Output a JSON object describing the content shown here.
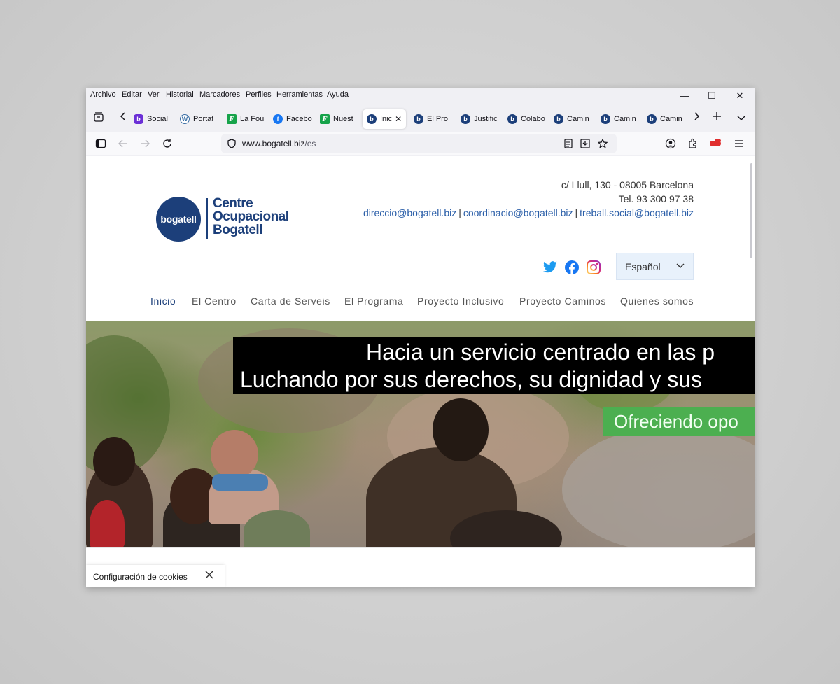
{
  "browser": {
    "menu": [
      "Archivo",
      "Editar",
      "Ver",
      "Historial",
      "Marcadores",
      "Perfiles",
      "Herramientas",
      "Ayuda"
    ],
    "window_controls": {
      "minimize": "—",
      "maximize": "☐",
      "close": "✕"
    },
    "tabs": [
      {
        "label": "Social",
        "icon": "social-icon"
      },
      {
        "label": "Portaf",
        "icon": "wordpress-icon"
      },
      {
        "label": "La Fou",
        "icon": "f-icon"
      },
      {
        "label": "Facebo",
        "icon": "facebook-icon"
      },
      {
        "label": "Nuest",
        "icon": "f-icon"
      },
      {
        "label": "Inic",
        "icon": "bogatell-icon",
        "active": true
      },
      {
        "label": "El Pro",
        "icon": "bogatell-icon"
      },
      {
        "label": "Justific",
        "icon": "bogatell-icon"
      },
      {
        "label": "Colabo",
        "icon": "bogatell-icon"
      },
      {
        "label": "Camin",
        "icon": "bogatell-icon"
      },
      {
        "label": "Camin",
        "icon": "bogatell-icon"
      },
      {
        "label": "Camin",
        "icon": "bogatell-icon"
      }
    ],
    "url": "www.bogatell.biz/es",
    "url_host": "www.bogatell.biz",
    "url_path": "/es"
  },
  "site": {
    "logo": {
      "badge": "bogatell",
      "line1": "Centre",
      "line2": "Ocupacional",
      "line3": "Bogatell",
      "color": "#1c3f7a"
    },
    "contact": {
      "address": "c/ Llull, 130 - 08005 Barcelona",
      "phone": "Tel. 93 300 97 38",
      "emails": [
        "direccio@bogatell.biz",
        "coordinacio@bogatell.biz",
        "treball.social@bogatell.biz"
      ],
      "separator": "|"
    },
    "social_icons": [
      "twitter-icon",
      "facebook-icon",
      "instagram-icon"
    ],
    "language": "Español",
    "nav": [
      {
        "label": "Inicio",
        "active": true
      },
      {
        "label": "El Centro"
      },
      {
        "label": "Carta de Serveis"
      },
      {
        "label": "El Programa"
      },
      {
        "label": "Proyecto Inclusivo"
      },
      {
        "label": "Proyecto Caminos"
      },
      {
        "label": "Quienes somos"
      }
    ],
    "hero": {
      "line1": "Hacia un servicio centrado en las p",
      "line2": "Luchando por sus derechos, su dignidad y sus",
      "green_text": "Ofreciendo opo",
      "green_color": "#4caf50"
    },
    "cookie": {
      "label": "Configuración de cookies"
    }
  }
}
